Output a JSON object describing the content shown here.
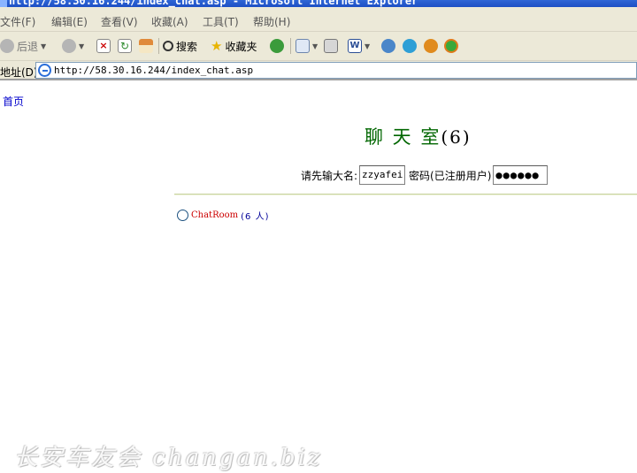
{
  "window": {
    "title": "http://58.30.16.244/index_chat.asp - Microsoft Internet Explorer"
  },
  "menu": [
    "文件(F)",
    "编辑(E)",
    "查看(V)",
    "收藏(A)",
    "工具(T)",
    "帮助(H)"
  ],
  "toolbar": {
    "back_label": "后退",
    "search_label": "搜索",
    "favorites_label": "收藏夹"
  },
  "address": {
    "label": "地址(D)",
    "url": "http://58.30.16.244/index_chat.asp"
  },
  "page": {
    "home_link": "首页",
    "title": "聊 天 室",
    "title_count": "(6)",
    "username_label": "请先输大名:",
    "username_value": "zzyafei",
    "password_label": "密码(已注册用户)",
    "password_value": "●●●●●●",
    "room_name": "ChatRoom",
    "room_count": "(6 人)"
  },
  "watermark": "长安车友会 changan.biz",
  "colors": {
    "title_green": "#006600",
    "room_red": "#cc0000",
    "link_blue": "#0000cc"
  }
}
